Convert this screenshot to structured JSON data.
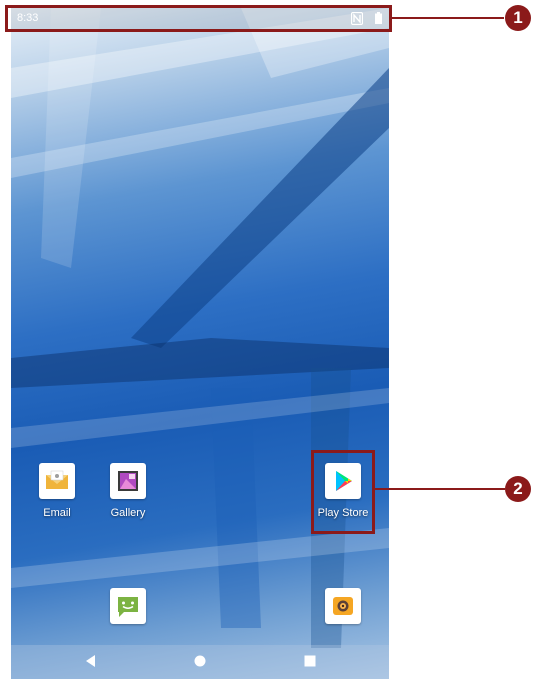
{
  "status_bar": {
    "time": "8:33",
    "icons": [
      "nfc-icon",
      "battery-icon"
    ]
  },
  "home_screen": {
    "apps": [
      {
        "label": "Email",
        "icon": "email-icon"
      },
      {
        "label": "Gallery",
        "icon": "gallery-icon"
      },
      {
        "label": "Play Store",
        "icon": "play-store-icon"
      }
    ],
    "dock": [
      {
        "icon": "messaging-icon"
      },
      {
        "icon": "camera-icon"
      }
    ]
  },
  "navigation": {
    "buttons": [
      "back-icon",
      "home-icon",
      "recents-icon"
    ]
  },
  "callouts": [
    {
      "number": "1"
    },
    {
      "number": "2"
    }
  ],
  "colors": {
    "callout": "#8b1a1a",
    "wallpaper_primary": "#2d6fc4",
    "status_text": "#ffffff"
  }
}
